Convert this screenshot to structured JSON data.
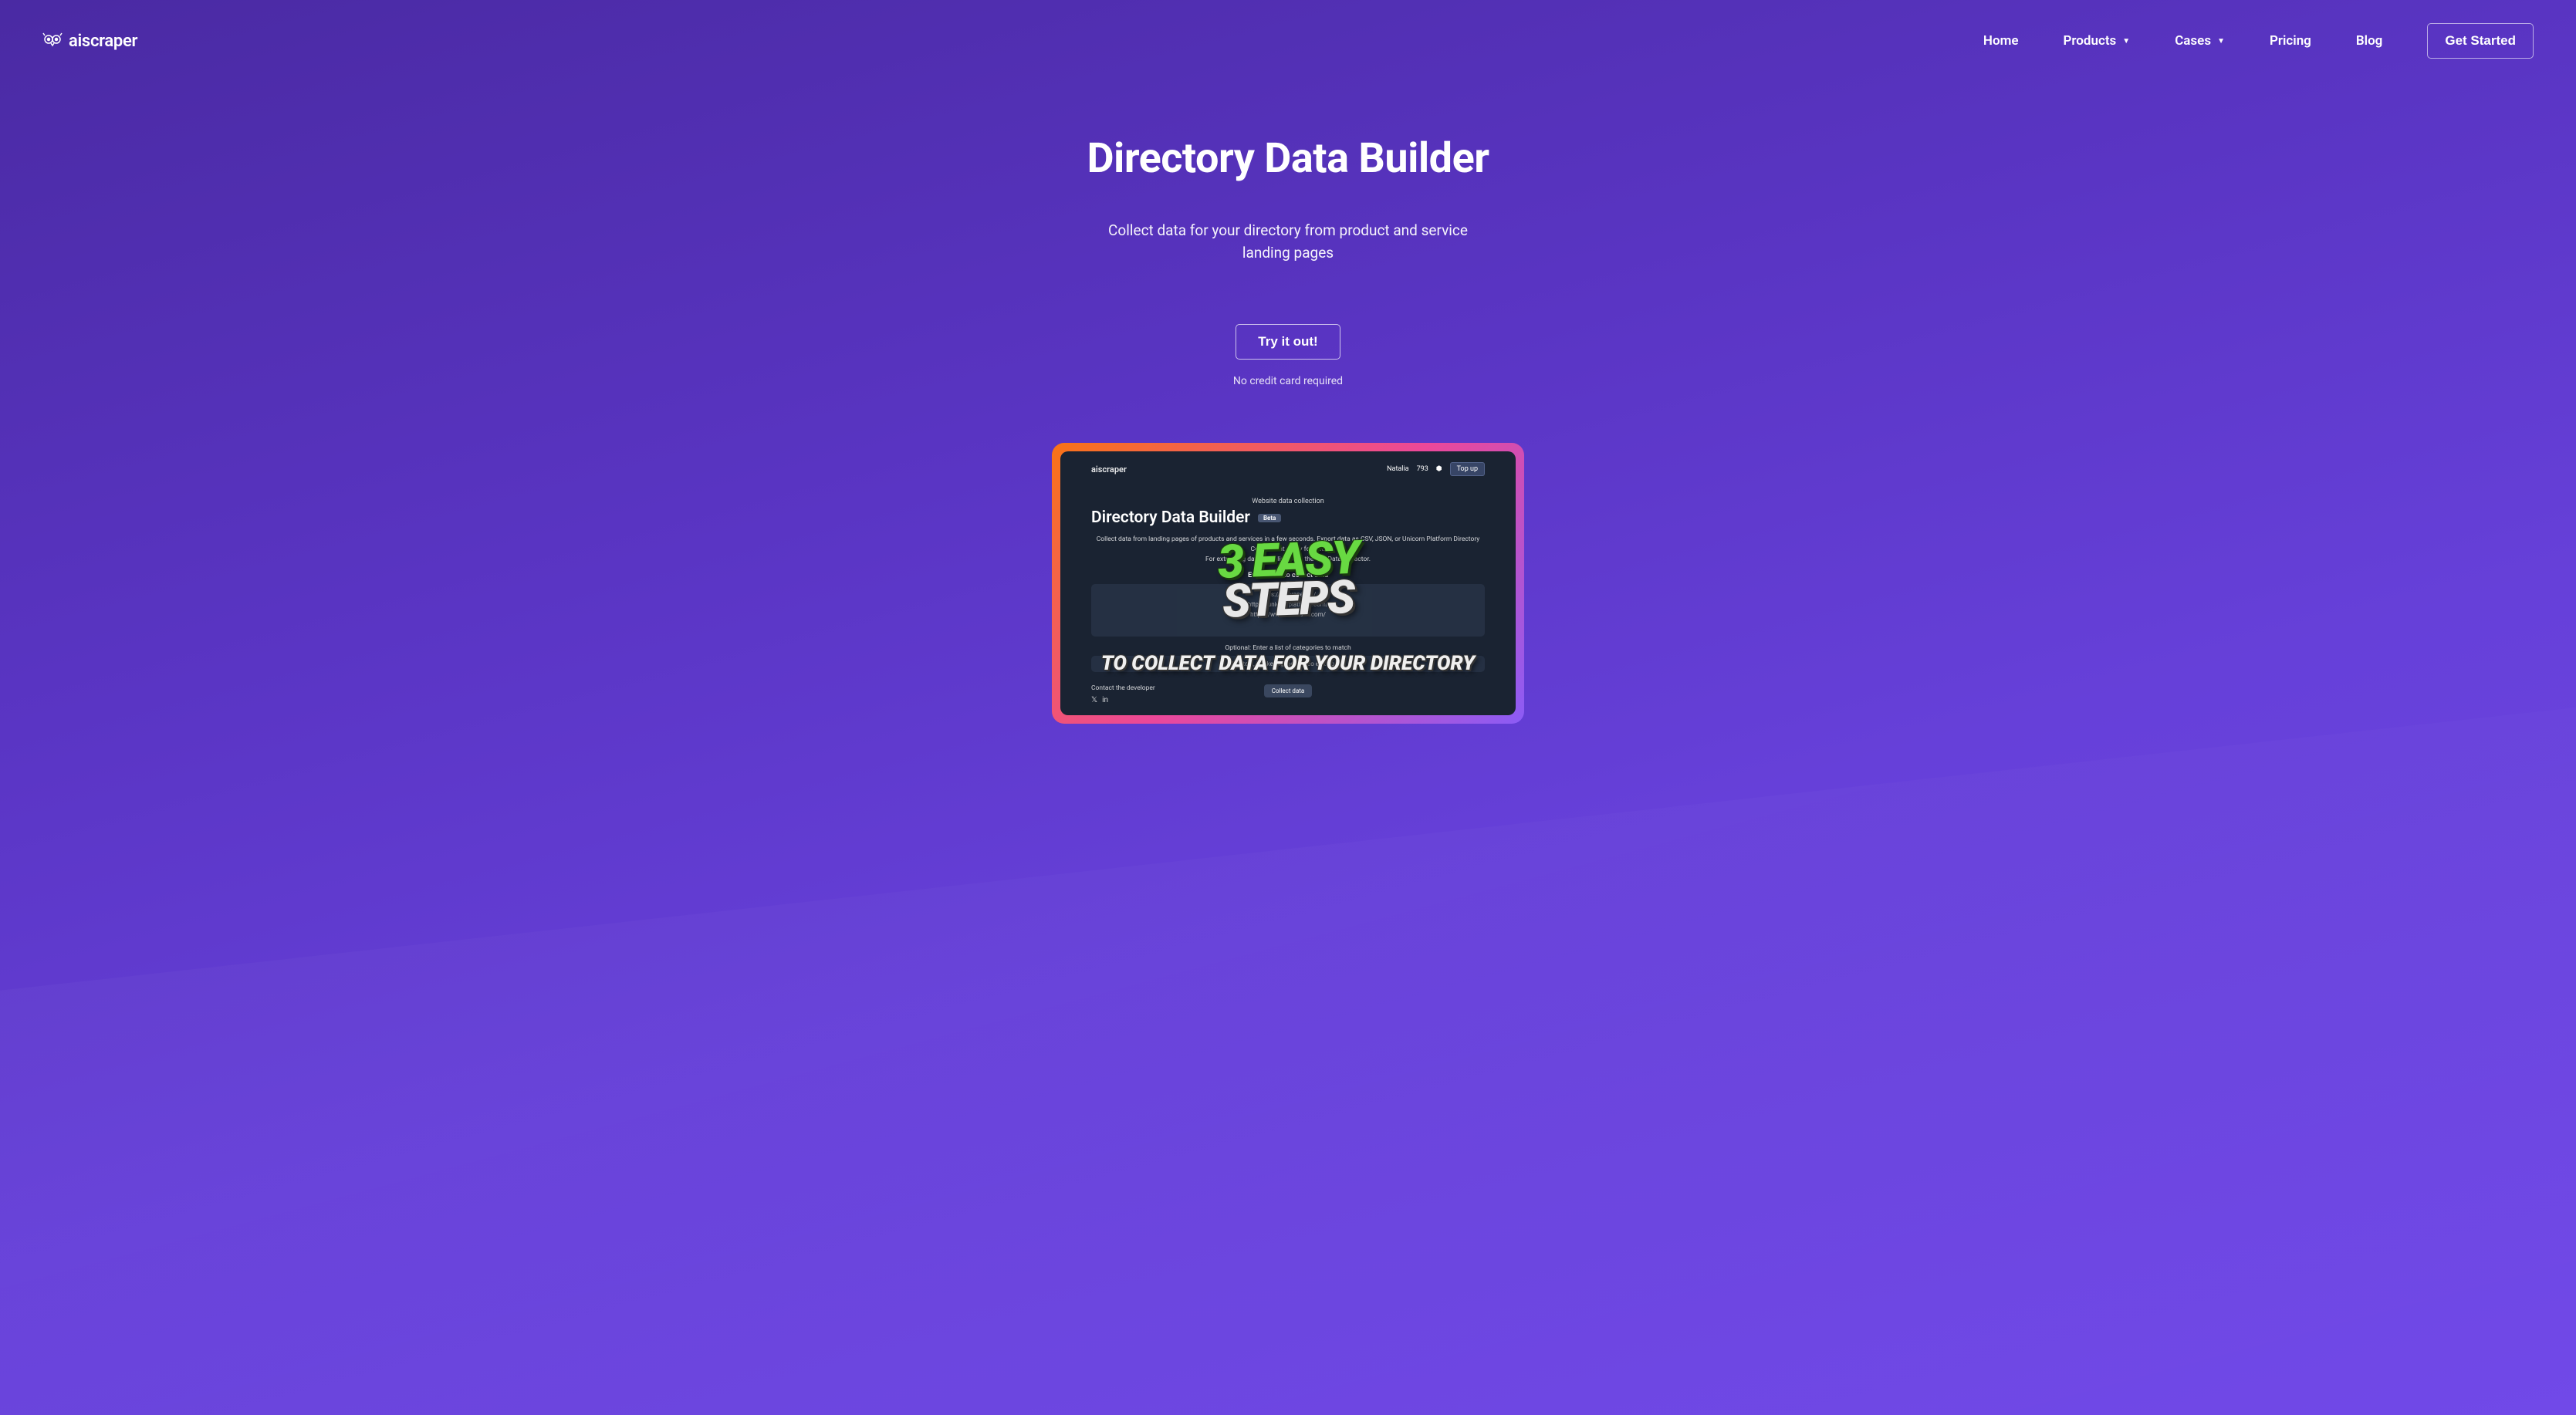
{
  "logo": {
    "text": "aiscraper"
  },
  "nav": {
    "home": "Home",
    "products": "Products",
    "cases": "Cases",
    "pricing": "Pricing",
    "blog": "Blog",
    "get_started": "Get Started"
  },
  "hero": {
    "title": "Directory Data Builder",
    "subtitle": "Collect data for your directory from product and service landing pages",
    "try_button": "Try it out!",
    "no_credit": "No credit card required"
  },
  "preview": {
    "logo": "aiscraper",
    "user_name": "Natalia",
    "user_balance": "793",
    "topup": "Top up",
    "breadcrumb": "Website data collection",
    "title": "Directory Data Builder",
    "badge": "Beta",
    "desc_line1": "Collect data from landing pages of products and services in a few seconds. Export data as CSV, JSON, or Unicorn Platform Directory Component ready format.",
    "desc_line2": "For extracting data from lists, use the List Data Extractor.",
    "label_urls": "Enter URLs to collect data",
    "url_sample1": "https://aiscraper.co/",
    "url_sample2": "https://unicornplatform.com/",
    "url_sample3": "https://www.semrush.com/",
    "optional_label": "Optional: Enter a list of categories to match",
    "optional_sample": "SEO tool, Marketing tool, Video editing app",
    "collect_button": "Collect data",
    "contact": "Contact the developer"
  },
  "overlay": {
    "top": "3 EASY",
    "mid": "STEPS",
    "bottom": "TO COLLECT DATA FOR YOUR DIRECTORY"
  }
}
